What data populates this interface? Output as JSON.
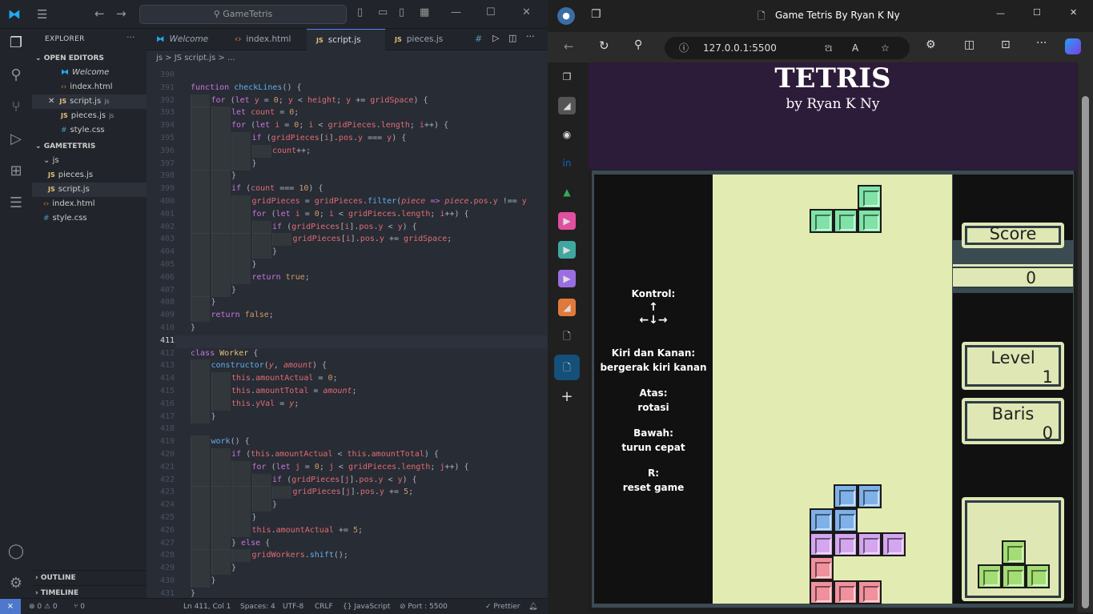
{
  "vscode": {
    "search": "GameTetris",
    "explorer_title": "EXPLORER",
    "open_editors_title": "OPEN EDITORS",
    "open_editors": [
      {
        "name": "Welcome",
        "type": "vsc",
        "closable": false
      },
      {
        "name": "index.html",
        "type": "html",
        "closable": false
      },
      {
        "name": "script.js",
        "suffix": "js",
        "type": "js",
        "closable": true
      },
      {
        "name": "pieces.js",
        "suffix": "js",
        "type": "js",
        "closable": false
      },
      {
        "name": "style.css",
        "type": "css",
        "closable": false
      }
    ],
    "project_title": "GAMETETRIS",
    "folder_js": "js",
    "tree": [
      "pieces.js",
      "script.js",
      "index.html",
      "style.css"
    ],
    "outline": "OUTLINE",
    "timeline": "TIMELINE",
    "tabs": [
      "Welcome",
      "index.html",
      "script.js",
      "pieces.js"
    ],
    "breadcrumb": "js > JS script.js > ...",
    "status": {
      "remote": "⨯",
      "problems": "⊗ 0 ⚠ 0",
      "ports": "⑂ 0",
      "position": "Ln 411, Col 1",
      "spaces": "Spaces: 4",
      "encoding": "UTF-8",
      "eol": "CRLF",
      "language": "{} JavaScript",
      "port": "⊘ Port : 5500",
      "prettier": "✓ Prettier"
    }
  },
  "edge": {
    "tab_title": "Game Tetris By Ryan K Ny",
    "url": "127.0.0.1:5500"
  },
  "tetris": {
    "title": "TETRIS",
    "subtitle": "by Ryan K Ny",
    "control_label": "Kontrol:",
    "up_arrow": "↑",
    "arrows": "←↓→",
    "left_right_label": "Kiri dan Kanan:",
    "left_right_desc": "bergerak kiri kanan",
    "up_label": "Atas:",
    "up_desc": "rotasi",
    "down_label": "Bawah:",
    "down_desc": "turun cepat",
    "r_label": "R:",
    "r_desc": "reset game",
    "score_label": "Score",
    "score_value": "0",
    "level_label": "Level",
    "level_value": "1",
    "lines_label": "Baris",
    "lines_value": "0",
    "colors": {
      "green": "#7fe3a8",
      "blue": "#7fb1e8",
      "purple": "#d4a6ef",
      "red": "#f0919d",
      "next": "#a3dd74"
    }
  }
}
